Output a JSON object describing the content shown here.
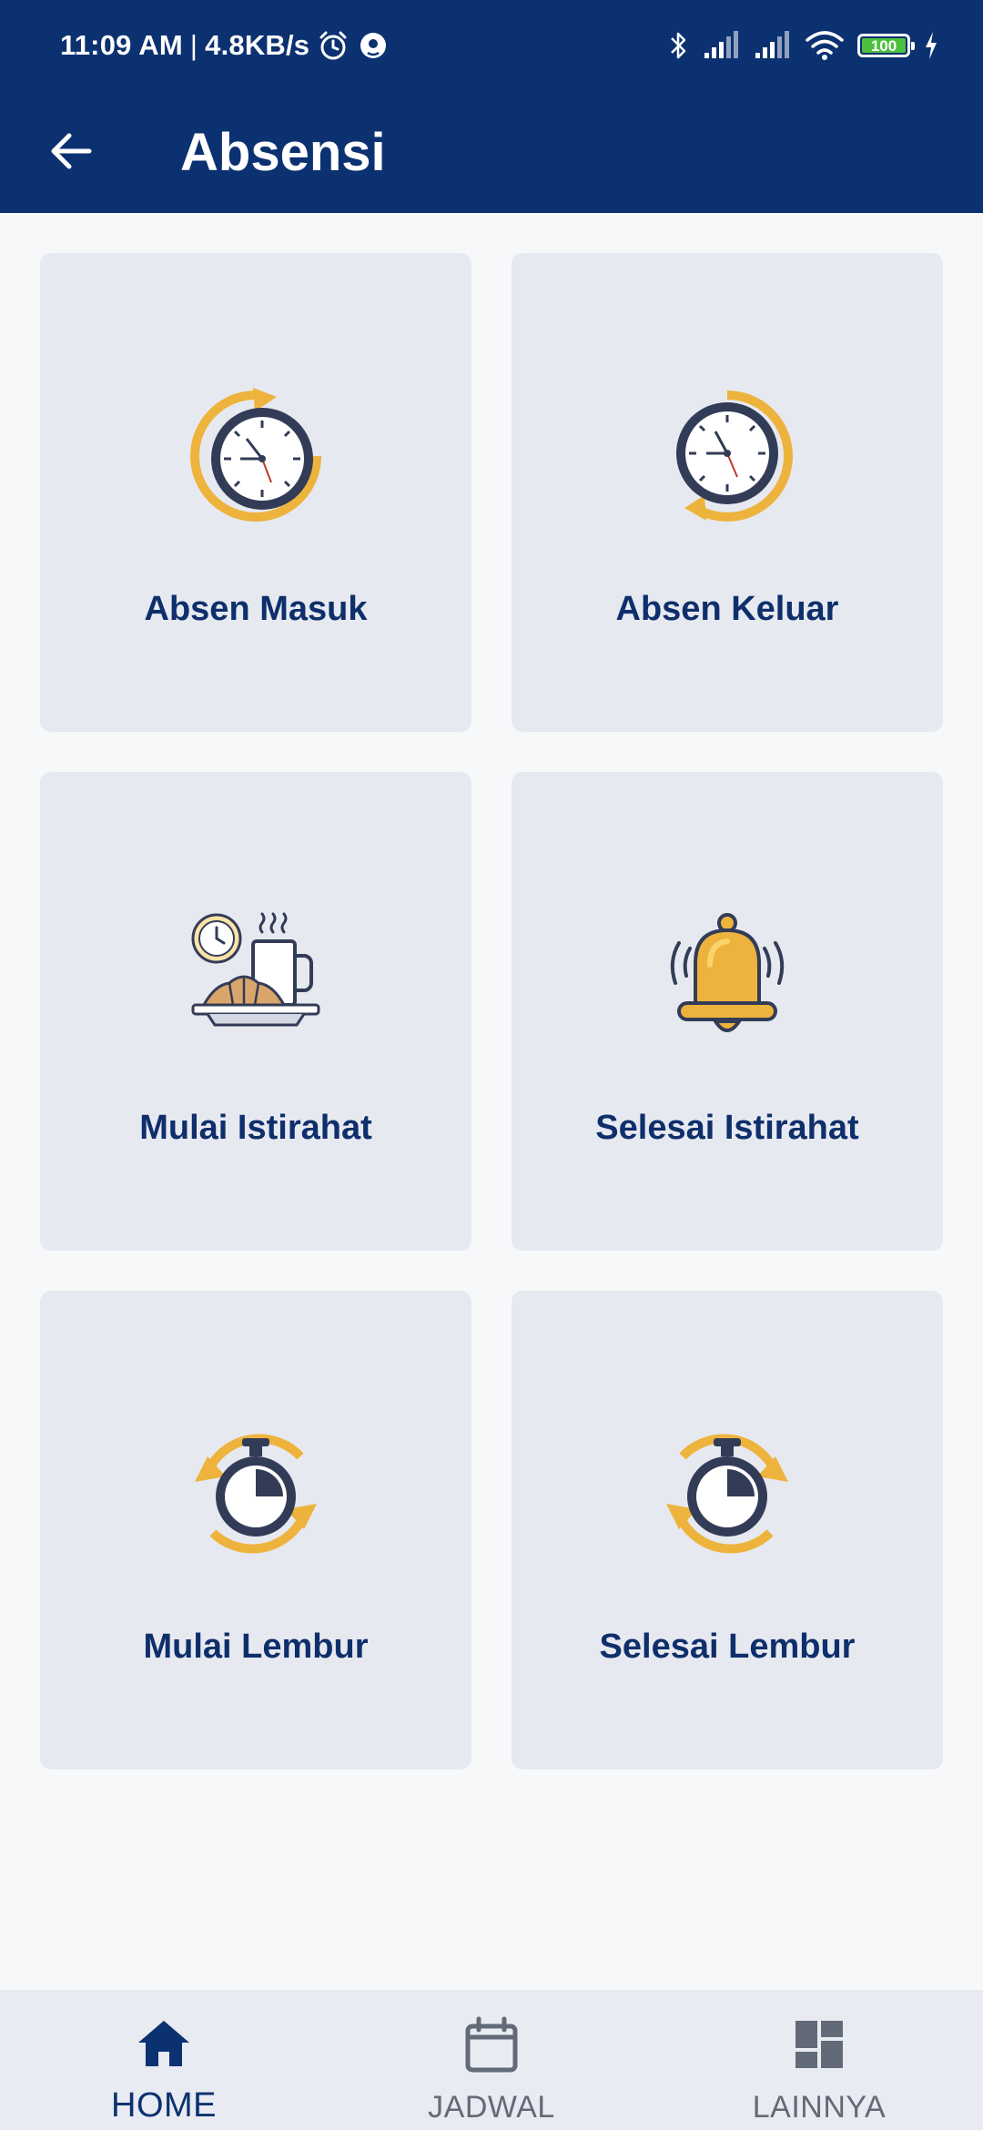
{
  "status_bar": {
    "time": "11:09 AM",
    "separator": "|",
    "net_speed": "4.8KB/s",
    "battery": "100",
    "icons": [
      "alarm-icon",
      "location-icon",
      "bluetooth-icon",
      "signal-icon",
      "signal-icon",
      "wifi-icon",
      "battery-icon",
      "charging-icon"
    ]
  },
  "app_bar": {
    "title": "Absensi",
    "back_icon": "arrow-back-icon"
  },
  "menu": {
    "items": [
      {
        "label": "Absen Masuk",
        "icon": "clock-clockwise-icon"
      },
      {
        "label": "Absen Keluar",
        "icon": "clock-counterclockwise-icon"
      },
      {
        "label": "Mulai Istirahat",
        "icon": "coffee-break-icon"
      },
      {
        "label": "Selesai Istirahat",
        "icon": "bell-icon"
      },
      {
        "label": "Mulai Lembur",
        "icon": "stopwatch-clockwise-icon"
      },
      {
        "label": "Selesai Lembur",
        "icon": "stopwatch-counterclockwise-icon"
      }
    ]
  },
  "bottom_nav": {
    "items": [
      {
        "label": "HOME",
        "icon": "home-icon",
        "active": true
      },
      {
        "label": "JADWAL",
        "icon": "calendar-icon",
        "active": false
      },
      {
        "label": "LAINNYA",
        "icon": "dashboard-icon",
        "active": false
      }
    ]
  },
  "colors": {
    "primary": "#0B3170",
    "accent": "#EDB33C",
    "card_bg": "#E7E9F0",
    "page_bg": "#F7F8FA",
    "nav_bg": "#E9EBF2",
    "inactive": "#636A77"
  }
}
